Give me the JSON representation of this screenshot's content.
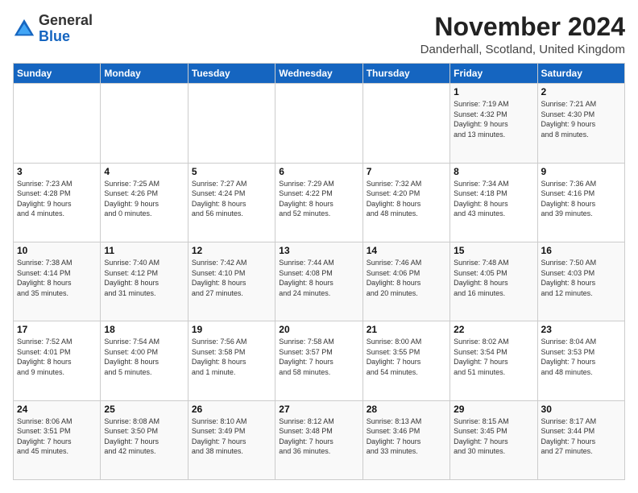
{
  "logo": {
    "general": "General",
    "blue": "Blue"
  },
  "title": "November 2024",
  "location": "Danderhall, Scotland, United Kingdom",
  "days_of_week": [
    "Sunday",
    "Monday",
    "Tuesday",
    "Wednesday",
    "Thursday",
    "Friday",
    "Saturday"
  ],
  "weeks": [
    [
      {
        "day": "",
        "info": ""
      },
      {
        "day": "",
        "info": ""
      },
      {
        "day": "",
        "info": ""
      },
      {
        "day": "",
        "info": ""
      },
      {
        "day": "",
        "info": ""
      },
      {
        "day": "1",
        "info": "Sunrise: 7:19 AM\nSunset: 4:32 PM\nDaylight: 9 hours\nand 13 minutes."
      },
      {
        "day": "2",
        "info": "Sunrise: 7:21 AM\nSunset: 4:30 PM\nDaylight: 9 hours\nand 8 minutes."
      }
    ],
    [
      {
        "day": "3",
        "info": "Sunrise: 7:23 AM\nSunset: 4:28 PM\nDaylight: 9 hours\nand 4 minutes."
      },
      {
        "day": "4",
        "info": "Sunrise: 7:25 AM\nSunset: 4:26 PM\nDaylight: 9 hours\nand 0 minutes."
      },
      {
        "day": "5",
        "info": "Sunrise: 7:27 AM\nSunset: 4:24 PM\nDaylight: 8 hours\nand 56 minutes."
      },
      {
        "day": "6",
        "info": "Sunrise: 7:29 AM\nSunset: 4:22 PM\nDaylight: 8 hours\nand 52 minutes."
      },
      {
        "day": "7",
        "info": "Sunrise: 7:32 AM\nSunset: 4:20 PM\nDaylight: 8 hours\nand 48 minutes."
      },
      {
        "day": "8",
        "info": "Sunrise: 7:34 AM\nSunset: 4:18 PM\nDaylight: 8 hours\nand 43 minutes."
      },
      {
        "day": "9",
        "info": "Sunrise: 7:36 AM\nSunset: 4:16 PM\nDaylight: 8 hours\nand 39 minutes."
      }
    ],
    [
      {
        "day": "10",
        "info": "Sunrise: 7:38 AM\nSunset: 4:14 PM\nDaylight: 8 hours\nand 35 minutes."
      },
      {
        "day": "11",
        "info": "Sunrise: 7:40 AM\nSunset: 4:12 PM\nDaylight: 8 hours\nand 31 minutes."
      },
      {
        "day": "12",
        "info": "Sunrise: 7:42 AM\nSunset: 4:10 PM\nDaylight: 8 hours\nand 27 minutes."
      },
      {
        "day": "13",
        "info": "Sunrise: 7:44 AM\nSunset: 4:08 PM\nDaylight: 8 hours\nand 24 minutes."
      },
      {
        "day": "14",
        "info": "Sunrise: 7:46 AM\nSunset: 4:06 PM\nDaylight: 8 hours\nand 20 minutes."
      },
      {
        "day": "15",
        "info": "Sunrise: 7:48 AM\nSunset: 4:05 PM\nDaylight: 8 hours\nand 16 minutes."
      },
      {
        "day": "16",
        "info": "Sunrise: 7:50 AM\nSunset: 4:03 PM\nDaylight: 8 hours\nand 12 minutes."
      }
    ],
    [
      {
        "day": "17",
        "info": "Sunrise: 7:52 AM\nSunset: 4:01 PM\nDaylight: 8 hours\nand 9 minutes."
      },
      {
        "day": "18",
        "info": "Sunrise: 7:54 AM\nSunset: 4:00 PM\nDaylight: 8 hours\nand 5 minutes."
      },
      {
        "day": "19",
        "info": "Sunrise: 7:56 AM\nSunset: 3:58 PM\nDaylight: 8 hours\nand 1 minute."
      },
      {
        "day": "20",
        "info": "Sunrise: 7:58 AM\nSunset: 3:57 PM\nDaylight: 7 hours\nand 58 minutes."
      },
      {
        "day": "21",
        "info": "Sunrise: 8:00 AM\nSunset: 3:55 PM\nDaylight: 7 hours\nand 54 minutes."
      },
      {
        "day": "22",
        "info": "Sunrise: 8:02 AM\nSunset: 3:54 PM\nDaylight: 7 hours\nand 51 minutes."
      },
      {
        "day": "23",
        "info": "Sunrise: 8:04 AM\nSunset: 3:53 PM\nDaylight: 7 hours\nand 48 minutes."
      }
    ],
    [
      {
        "day": "24",
        "info": "Sunrise: 8:06 AM\nSunset: 3:51 PM\nDaylight: 7 hours\nand 45 minutes."
      },
      {
        "day": "25",
        "info": "Sunrise: 8:08 AM\nSunset: 3:50 PM\nDaylight: 7 hours\nand 42 minutes."
      },
      {
        "day": "26",
        "info": "Sunrise: 8:10 AM\nSunset: 3:49 PM\nDaylight: 7 hours\nand 38 minutes."
      },
      {
        "day": "27",
        "info": "Sunrise: 8:12 AM\nSunset: 3:48 PM\nDaylight: 7 hours\nand 36 minutes."
      },
      {
        "day": "28",
        "info": "Sunrise: 8:13 AM\nSunset: 3:46 PM\nDaylight: 7 hours\nand 33 minutes."
      },
      {
        "day": "29",
        "info": "Sunrise: 8:15 AM\nSunset: 3:45 PM\nDaylight: 7 hours\nand 30 minutes."
      },
      {
        "day": "30",
        "info": "Sunrise: 8:17 AM\nSunset: 3:44 PM\nDaylight: 7 hours\nand 27 minutes."
      }
    ]
  ]
}
